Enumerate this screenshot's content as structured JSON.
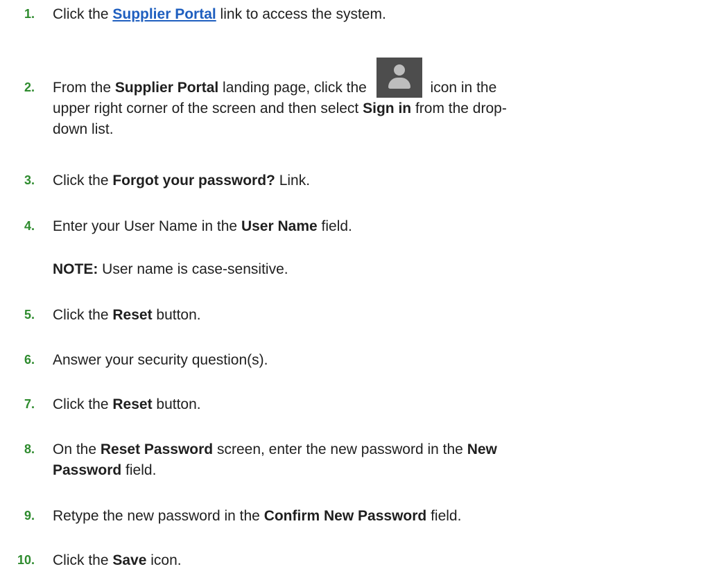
{
  "steps": [
    {
      "num": "1.",
      "pre": "Click the ",
      "link": "Supplier Portal",
      "post": " link to access the system."
    },
    {
      "num": "2.",
      "pre": "From the ",
      "b1": "Supplier Portal",
      "mid": " landing page, click the ",
      "icon": "user-avatar-icon",
      "mid2": " icon in the",
      "line2": "upper right corner of the screen and then select ",
      "b2": "Sign in",
      "post": " from the drop-",
      "line3": "down list."
    },
    {
      "num": "3.",
      "pre": "Click the ",
      "b1": "Forgot your password?",
      "post": " Link."
    },
    {
      "num": "4.",
      "pre": "Enter your User Name in the ",
      "b1": "User Name",
      "post": " field."
    },
    {
      "note_label": "NOTE:",
      "note_text": " User name is case-sensitive."
    },
    {
      "num": "5.",
      "pre": "Click the ",
      "b1": "Reset",
      "post": " button."
    },
    {
      "num": "6.",
      "pre": "Answer your security question(s)."
    },
    {
      "num": "7.",
      "pre": "Click the ",
      "b1": "Reset",
      "post": " button."
    },
    {
      "num": "8.",
      "pre": "On the ",
      "b1": "Reset Password",
      "mid": " screen, enter the new password in the ",
      "b2": "New",
      "line2b": "Password",
      "post": " field."
    },
    {
      "num": "9.",
      "pre": "Retype the new password in the ",
      "b1": "Confirm New Password",
      "post": " field."
    },
    {
      "num": "10.",
      "pre": "Click the ",
      "b1": "Save",
      "post": " icon."
    }
  ],
  "colors": {
    "number": "#2e8b2e",
    "link": "#1f5fbf",
    "avatar_bg": "#4d4d4d",
    "avatar_fg": "#bdbdbd"
  }
}
